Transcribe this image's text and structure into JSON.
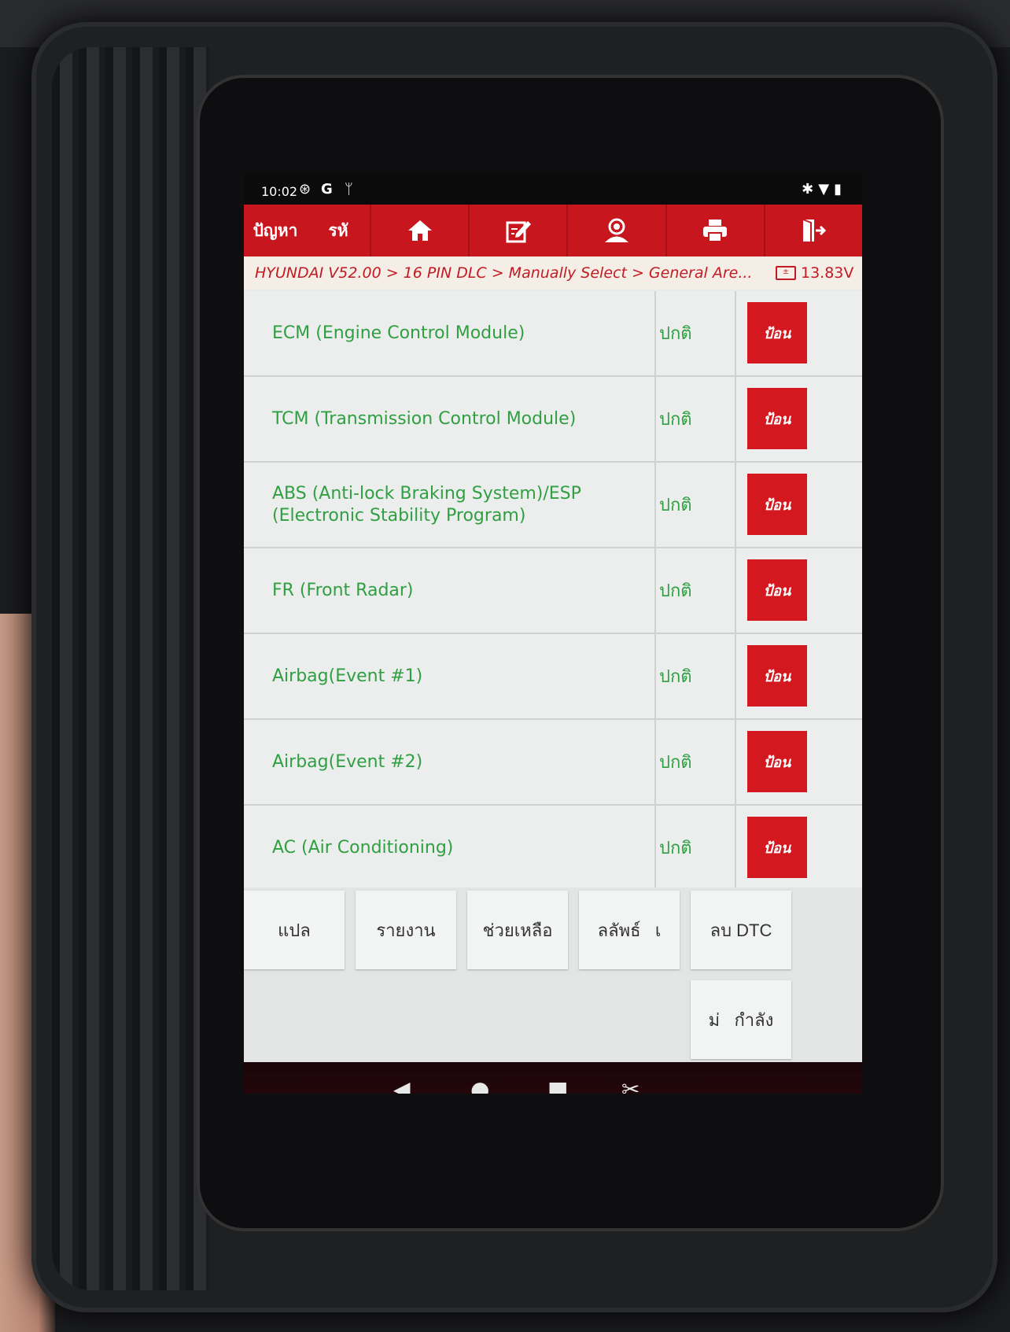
{
  "status_bar": {
    "time": "10:02",
    "left_icons": [
      "settings-badge-icon",
      "google-g-icon",
      "usb-icon"
    ],
    "right_icons": [
      "bluetooth-icon",
      "wifi-icon",
      "battery-icon"
    ]
  },
  "toolbar": {
    "tab1": "ปัญหา",
    "tab2": "รหั",
    "buttons": [
      "home-icon",
      "edit-icon",
      "user-icon",
      "print-icon",
      "exit-icon"
    ]
  },
  "breadcrumb": {
    "path": "HYUNDAI V52.00 > 16 PIN DLC > Manually Select > General Are...",
    "voltage": "13.83V"
  },
  "modules": [
    {
      "name": "ECM (Engine Control Module)",
      "status": "ปกติ",
      "action": "ป้อน"
    },
    {
      "name": "TCM (Transmission Control Module)",
      "status": "ปกติ",
      "action": "ป้อน"
    },
    {
      "name": "ABS (Anti-lock Braking System)/ESP (Electronic Stability Program)",
      "status": "ปกติ",
      "action": "ป้อน"
    },
    {
      "name": "FR (Front Radar)",
      "status": "ปกติ",
      "action": "ป้อน"
    },
    {
      "name": "Airbag(Event #1)",
      "status": "ปกติ",
      "action": "ป้อน"
    },
    {
      "name": "Airbag(Event #2)",
      "status": "ปกติ",
      "action": "ป้อน"
    },
    {
      "name": "AC (Air Conditioning)",
      "status": "ปกติ",
      "action": "ป้อน"
    }
  ],
  "bottom_buttons": {
    "translate": "แปล",
    "report": "รายงาน",
    "help": "ช่วยเหลือ",
    "result": "ลลัพธ์   เ",
    "clear_dtc": "ลบ DTC",
    "in_progress": "ม่   กำลัง"
  },
  "nav_bar": [
    "back-icon",
    "home-circle-icon",
    "recents-icon",
    "screenshot-icon"
  ],
  "colors": {
    "accent": "#c8161f",
    "status_green": "#2f9f42",
    "panel": "#e9ebea"
  }
}
